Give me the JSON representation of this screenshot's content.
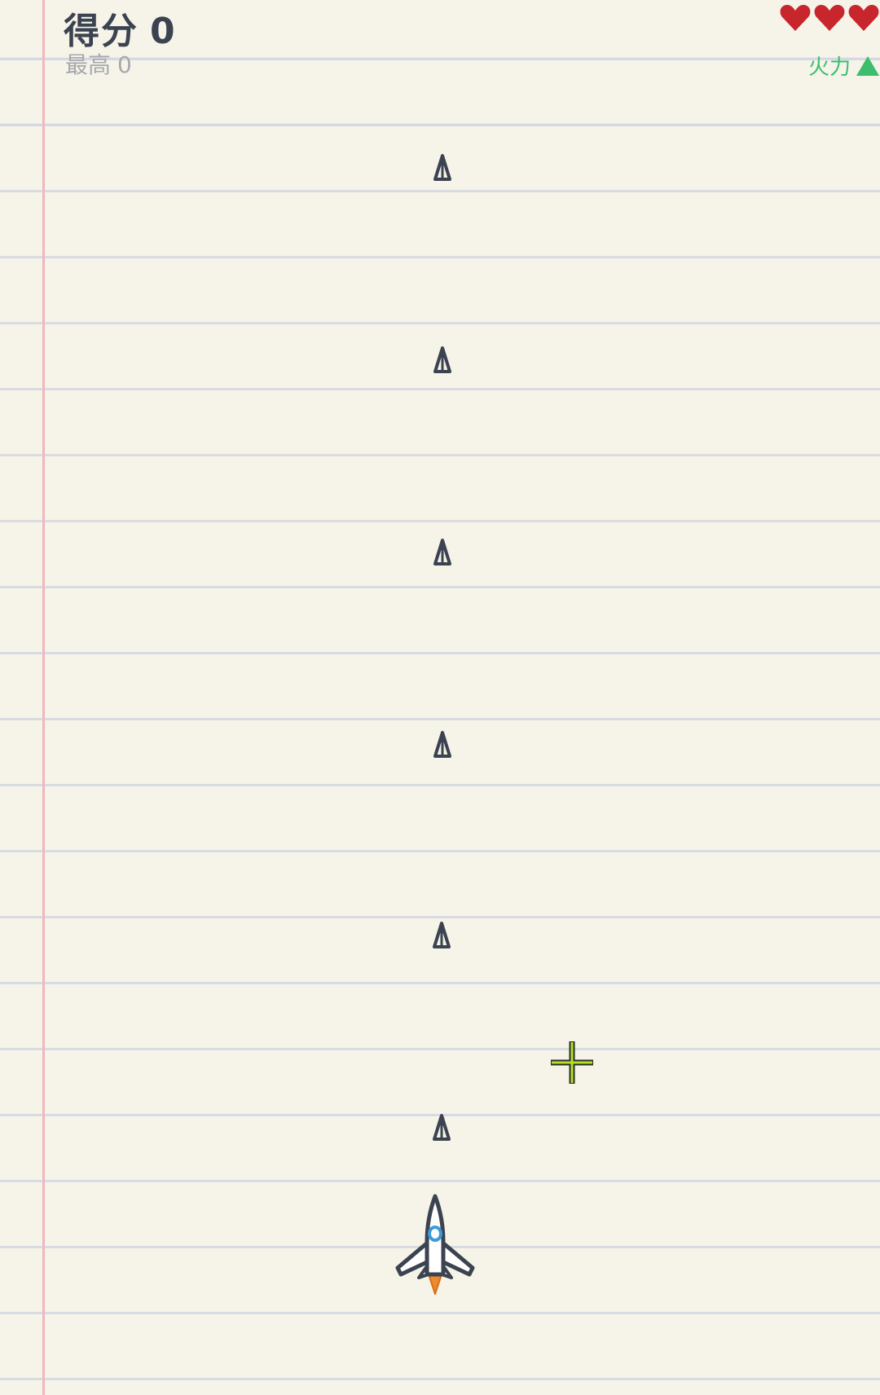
{
  "hud": {
    "score_label": "得分",
    "score_value": "0",
    "best_label": "最高",
    "best_value": "0",
    "lives": 3,
    "power_label": "火力",
    "power_icon": "up-arrow-icon"
  },
  "colors": {
    "paper": "#f6f3e8",
    "rule_line": "#d5d8e2",
    "margin_line": "#f0b8bd",
    "heart": "#c8262d",
    "power": "#3bbf6c",
    "ink": "#3b4350",
    "player_cockpit": "#3c9ad6",
    "player_flame": "#ec8a2d",
    "crosshair": "#b4e028"
  },
  "entities": {
    "bullet_count": 6,
    "player_icon": "jet-fighter-icon",
    "cursor_icon": "crosshair-icon"
  }
}
